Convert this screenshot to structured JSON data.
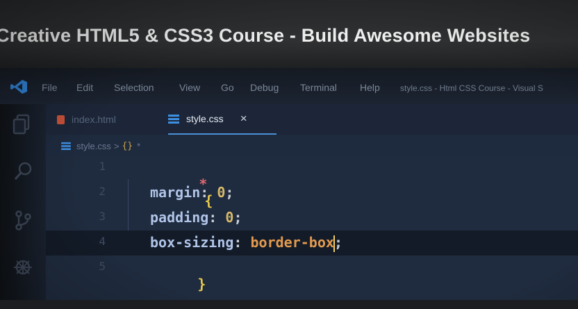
{
  "banner": {
    "title": "Creative HTML5 & CSS3 Course - Build Awesome Websites"
  },
  "menu": {
    "items": [
      "File",
      "Edit",
      "Selection",
      "View",
      "Go",
      "Debug",
      "Terminal",
      "Help"
    ],
    "window_title": "style.css - Html CSS Course - Visual S"
  },
  "tabs": [
    {
      "label": "index.html",
      "active": false,
      "icon": "html-file-icon"
    },
    {
      "label": "style.css",
      "active": true,
      "icon": "css-file-icon",
      "close": "×"
    }
  ],
  "breadcrumb": {
    "file": "style.css",
    "separator": ">",
    "symbol": "*"
  },
  "editor": {
    "line_numbers": [
      "1",
      "2",
      "3",
      "4",
      "5"
    ],
    "code": [
      {
        "selector": "*",
        "brace": "{"
      },
      {
        "property": "margin",
        "value": "0"
      },
      {
        "property": "padding",
        "value": "0"
      },
      {
        "property": "box-sizing",
        "value": "border-box"
      },
      {
        "brace": "}"
      }
    ],
    "current_line": 4
  },
  "activity_icons": [
    "explorer-icon",
    "search-icon",
    "source-control-icon",
    "debug-icon"
  ],
  "colors": {
    "accent": "#4a8fd6",
    "selector": "#e06a72",
    "brace": "#e8c84c",
    "property": "#b0c4e8",
    "value": "#e39a4e"
  }
}
